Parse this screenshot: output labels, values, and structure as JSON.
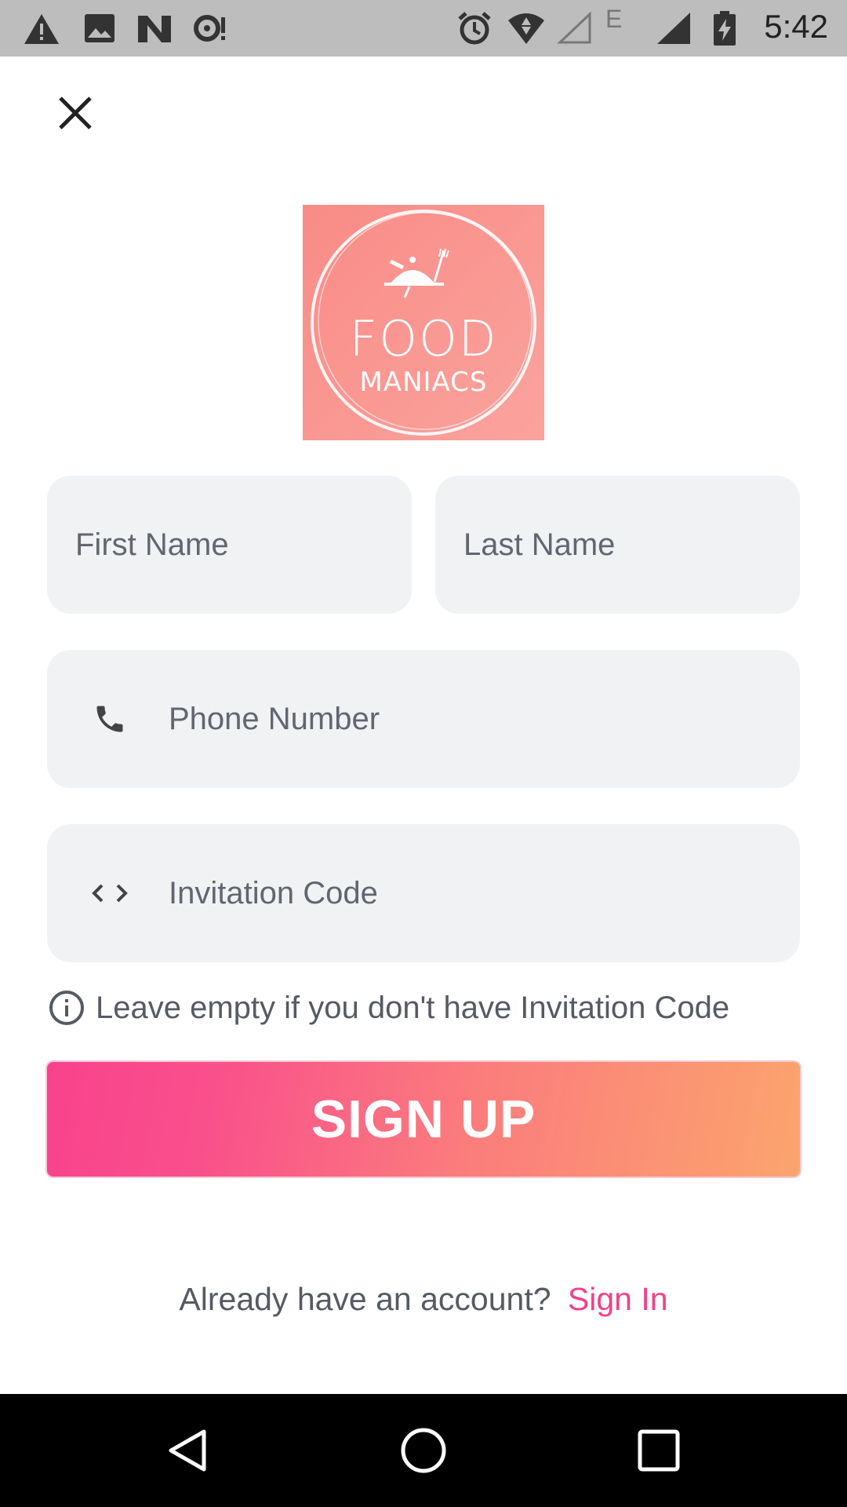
{
  "status_bar": {
    "time": "5:42",
    "left_icons": [
      "alert-icon",
      "image-icon",
      "n-icon",
      "sync-alert-icon"
    ],
    "right_icons": [
      "alarm-icon",
      "wifi-icon",
      "signal-empty-icon",
      "edge-icon",
      "signal-full-icon",
      "battery-charging-icon"
    ],
    "edge_label": "E"
  },
  "header": {
    "close_icon": "close-icon"
  },
  "logo": {
    "line1": "FOOD",
    "line2": "MANIACS",
    "bg_color": "#f98b86"
  },
  "form": {
    "first_name": {
      "placeholder": "First Name",
      "value": ""
    },
    "last_name": {
      "placeholder": "Last Name",
      "value": ""
    },
    "phone": {
      "placeholder": "Phone Number",
      "value": "",
      "icon": "phone-icon"
    },
    "invitation_code": {
      "placeholder": "Invitation Code",
      "value": "",
      "icon": "code-icon"
    },
    "hint": {
      "icon": "info-icon",
      "text": "Leave empty if you don't have Invitation Code"
    }
  },
  "signup_button": {
    "label": "SIGN UP",
    "gradient_start": "#f9428d",
    "gradient_end": "#fba46d"
  },
  "footer": {
    "prompt": "Already have an account?",
    "link": "Sign In",
    "link_color": "#f0428a"
  },
  "nav_bar": {
    "buttons": [
      "back-icon",
      "home-icon",
      "recents-icon"
    ]
  }
}
